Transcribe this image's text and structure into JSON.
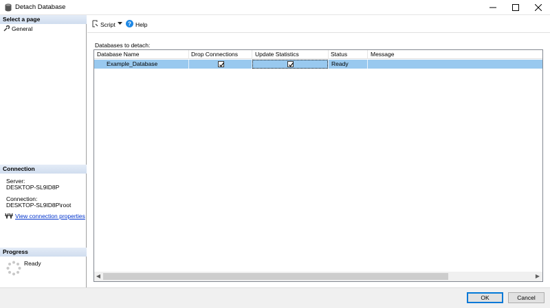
{
  "window": {
    "title": "Detach Database",
    "icon": "database-icon"
  },
  "left_panel": {
    "select_page_heading": "Select a page",
    "pages": [
      {
        "label": "General",
        "icon": "wrench-icon"
      }
    ],
    "connection_heading": "Connection",
    "server_label": "Server:",
    "server_value": "DESKTOP-SL9ID8P",
    "connection_label": "Connection:",
    "connection_value": "DESKTOP-SL9ID8P\\root",
    "view_connection_link": "View connection properties",
    "progress_heading": "Progress",
    "progress_status": "Ready"
  },
  "toolbar": {
    "script_label": "Script",
    "help_label": "Help"
  },
  "main": {
    "grid_label": "Databases to detach:",
    "columns": [
      "Database Name",
      "Drop Connections",
      "Update Statistics",
      "Status",
      "Message"
    ],
    "rows": [
      {
        "database_name": "Example_Database",
        "drop_connections": true,
        "update_statistics": true,
        "status": "Ready",
        "message": ""
      }
    ]
  },
  "footer": {
    "ok_label": "OK",
    "cancel_label": "Cancel"
  },
  "colors": {
    "selected_row": "#99c9ef",
    "section_header": "#d6e2f1",
    "link": "#0033cc",
    "default_button_border": "#0078d7"
  }
}
